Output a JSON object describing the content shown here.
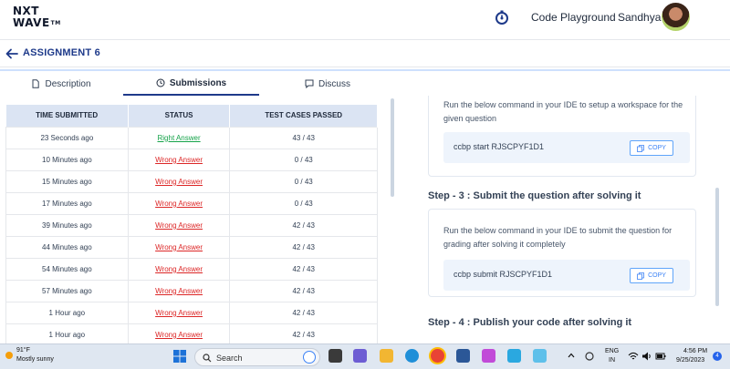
{
  "header": {
    "logo_line1": "NXT",
    "logo_line2": "WAVE",
    "logo_tm": "TM",
    "link": "Code Playground",
    "user_name": "Sandhya"
  },
  "titlebar": {
    "title": "ASSIGNMENT 6"
  },
  "tabs": [
    {
      "label": "Description",
      "icon": "document-icon",
      "active": false
    },
    {
      "label": "Submissions",
      "icon": "clock-icon",
      "active": true
    },
    {
      "label": "Discuss",
      "icon": "chat-icon",
      "active": false
    }
  ],
  "submissions": {
    "columns": [
      "TIME SUBMITTED",
      "STATUS",
      "TEST CASES PASSED"
    ],
    "rows": [
      {
        "time": "23 Seconds ago",
        "status": "Right Answer",
        "passed": "43 / 43"
      },
      {
        "time": "10 Minutes ago",
        "status": "Wrong Answer",
        "passed": "0 / 43"
      },
      {
        "time": "15 Minutes ago",
        "status": "Wrong Answer",
        "passed": "0 / 43"
      },
      {
        "time": "17 Minutes ago",
        "status": "Wrong Answer",
        "passed": "0 / 43"
      },
      {
        "time": "39 Minutes ago",
        "status": "Wrong Answer",
        "passed": "42 / 43"
      },
      {
        "time": "44 Minutes ago",
        "status": "Wrong Answer",
        "passed": "42 / 43"
      },
      {
        "time": "54 Minutes ago",
        "status": "Wrong Answer",
        "passed": "42 / 43"
      },
      {
        "time": "57 Minutes ago",
        "status": "Wrong Answer",
        "passed": "42 / 43"
      },
      {
        "time": "1 Hour ago",
        "status": "Wrong Answer",
        "passed": "42 / 43"
      },
      {
        "time": "1 Hour ago",
        "status": "Wrong Answer",
        "passed": "42 / 43"
      }
    ]
  },
  "instructions": {
    "card1_text": "Run the below command in your IDE to setup a workspace for the given question",
    "card1_command": "ccbp start RJSCPYF1D1",
    "step3_title": "Step - 3 : Submit the question after solving it",
    "card2_text": "Run the below command in your IDE to submit the question for grading after solving it completely",
    "card2_command": "ccbp submit RJSCPYF1D1",
    "copy_label": "COPY",
    "step4_title": "Step - 4 : Publish your code after solving it"
  },
  "taskbar": {
    "weather_temp": "91°F",
    "weather_desc": "Mostly sunny",
    "search_label": "Search",
    "lang_line1": "ENG",
    "lang_line2": "IN",
    "time": "4:56 PM",
    "date": "9/25/2023",
    "notification_count": "4"
  },
  "colors": {
    "accent": "#1e3a8a",
    "right_answer": "#16a34a",
    "wrong_answer": "#dc2626",
    "table_header_bg": "#dbe4f3",
    "command_bg": "#eef4fc"
  }
}
